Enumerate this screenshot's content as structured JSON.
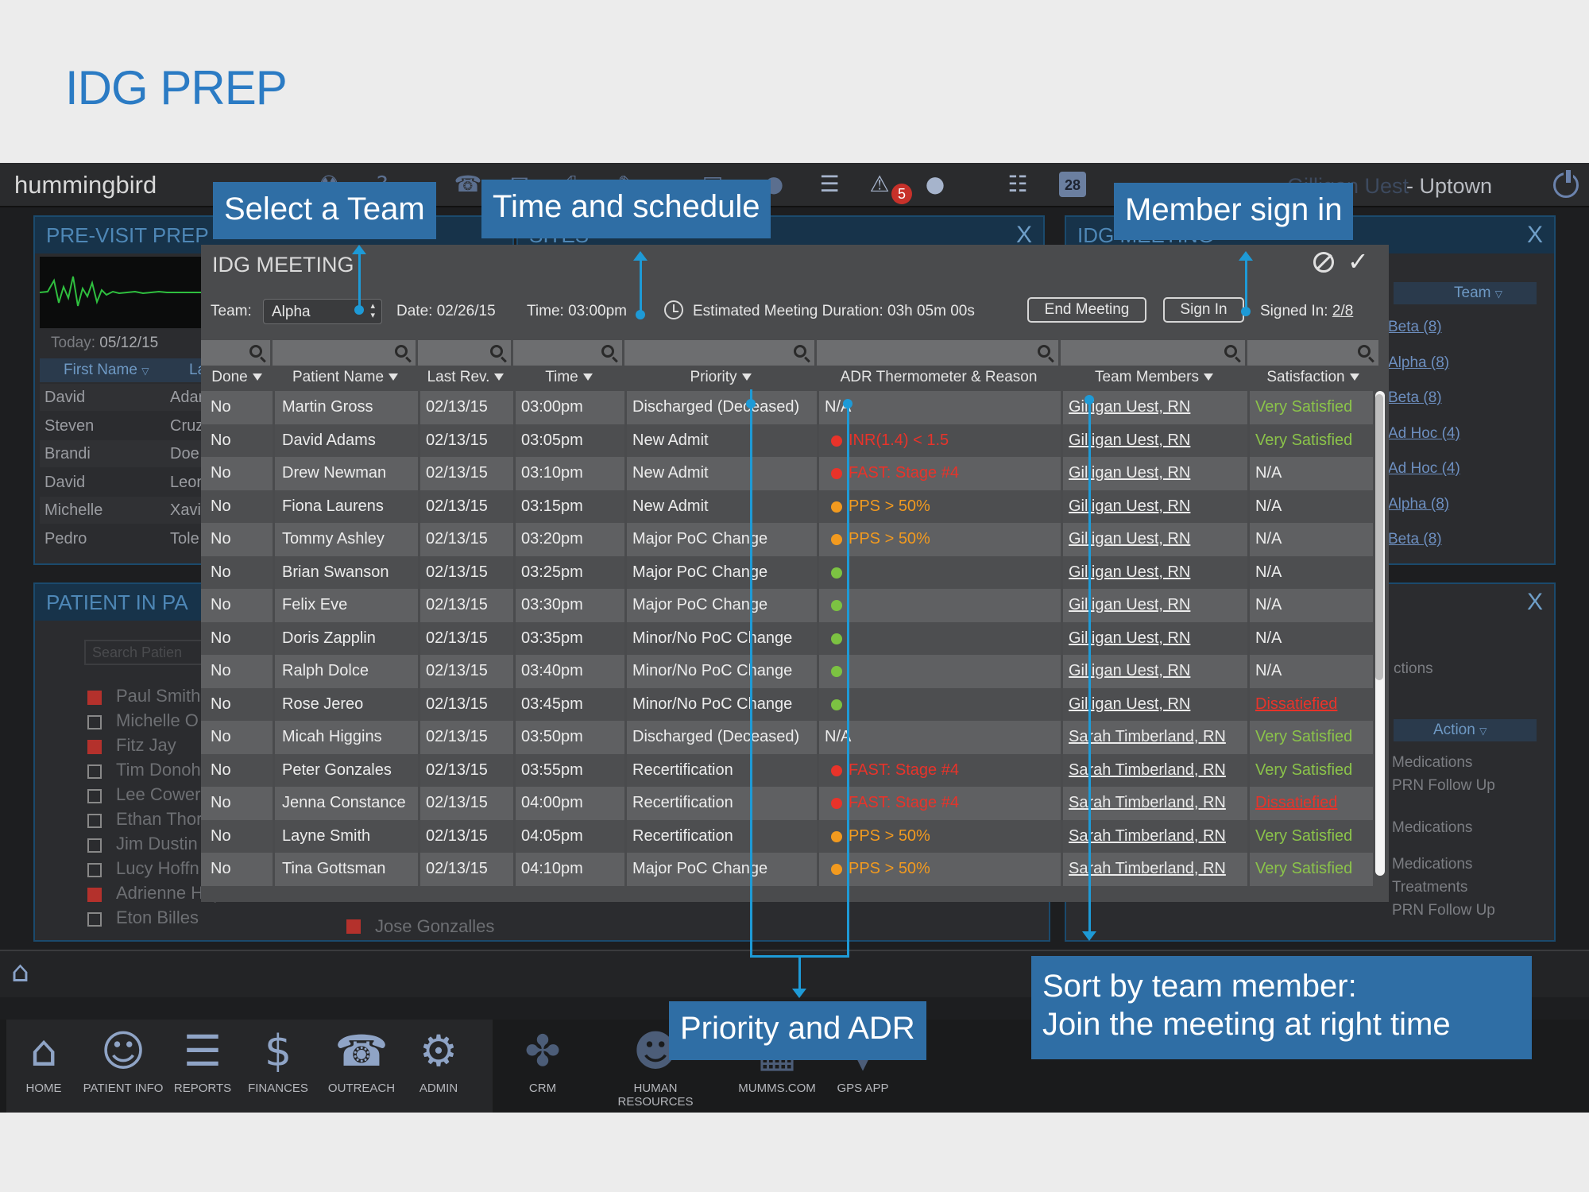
{
  "slide": {
    "title": "IDG PREP"
  },
  "topbar": {
    "brand": "hummingbird",
    "alert_count": "5",
    "calendar_day": "28",
    "user_name": "Gilligan Uest",
    "location": "- Uptown"
  },
  "previsit": {
    "title": "PRE-VISIT PREP",
    "today_label": "Today:",
    "today_value": "05/12/15",
    "col_first": "First Name",
    "col_last": "La",
    "rows": [
      {
        "first": "David",
        "last": "Adar"
      },
      {
        "first": "Steven",
        "last": "Cruz"
      },
      {
        "first": "Brandi",
        "last": "Doe"
      },
      {
        "first": "David",
        "last": "Leon"
      },
      {
        "first": "Michelle",
        "last": "Xavi"
      },
      {
        "first": "Pedro",
        "last": "Tole"
      }
    ]
  },
  "sites": {
    "title": "SITES"
  },
  "patient_panel": {
    "title": "PATIENT IN PA",
    "search_placeholder": "Search Patien",
    "items": [
      {
        "name": "Paul Smith",
        "checked": true
      },
      {
        "name": "Michelle O",
        "checked": false
      },
      {
        "name": "Fitz Jay",
        "checked": true
      },
      {
        "name": "Tim Donoh",
        "checked": false
      },
      {
        "name": "Lee Cower",
        "checked": false
      },
      {
        "name": "Ethan Thor",
        "checked": false
      },
      {
        "name": "Jim Dustin",
        "checked": false
      },
      {
        "name": "Lucy Hoffn",
        "checked": false
      },
      {
        "name": "Adrienne Hope",
        "checked": true
      },
      {
        "name": "Eton Billes",
        "checked": false
      }
    ],
    "extra_item": "Jose Gonzalles"
  },
  "idg_side": {
    "title": "IDG MEETING",
    "team_header": "Team",
    "teams": [
      "Beta (8)",
      "Alpha (8)",
      "Beta (8)",
      "Ad Hoc (4)",
      "Ad Hoc (4)",
      "Alpha (8)",
      "Beta (8)"
    ],
    "actions_label": "ctions",
    "action_header": "Action",
    "actions": [
      "Medications",
      "PRN Follow Up",
      "Medications",
      "Medications",
      "Treatments",
      "PRN Follow Up"
    ]
  },
  "modal": {
    "title": "IDG MEETING",
    "team_label": "Team:",
    "team_value": "Alpha",
    "date": "Date: 02/26/15",
    "time": "Time: 03:00pm",
    "duration": "Estimated Meeting Duration: 03h 05m 00s",
    "end_meeting": "End Meeting",
    "sign_in": "Sign In",
    "signed_label": "Signed In:",
    "signed_value": "2/8",
    "columns": {
      "done": "Done",
      "patient": "Patient Name",
      "last_rev": "Last Rev.",
      "time": "Time",
      "priority": "Priority",
      "adr": "ADR Thermometer & Reason",
      "team": "Team Members",
      "satisfaction": "Satisfaction"
    },
    "rows": [
      {
        "done": "No",
        "patient": "Martin Gross",
        "rev": "02/13/15",
        "time": "03:00pm",
        "priority": "Discharged (Deceased)",
        "adr_dot": "",
        "adr_text": "N/A",
        "adr_color": "#ececec",
        "member": "Gilligan Uest, RN",
        "sat": "Very Satisfied",
        "sat_class": "sat-green"
      },
      {
        "done": "No",
        "patient": "David Adams",
        "rev": "02/13/15",
        "time": "03:05pm",
        "priority": "New Admit",
        "adr_dot": "#e8332a",
        "adr_text": "INR(1.4) < 1.5",
        "adr_color": "#e8332a",
        "member": "Gilligan Uest, RN",
        "sat": "Very Satisfied",
        "sat_class": "sat-green"
      },
      {
        "done": "No",
        "patient": "Drew Newman",
        "rev": "02/13/15",
        "time": "03:10pm",
        "priority": "New Admit",
        "adr_dot": "#e8332a",
        "adr_text": "FAST: Stage #4",
        "adr_color": "#e8332a",
        "member": "Gilligan Uest, RN",
        "sat": "N/A",
        "sat_class": ""
      },
      {
        "done": "No",
        "patient": "Fiona Laurens",
        "rev": "02/13/15",
        "time": "03:15pm",
        "priority": "New Admit",
        "adr_dot": "#f29a1f",
        "adr_text": "PPS > 50%",
        "adr_color": "#f29a1f",
        "member": "Gilligan Uest, RN",
        "sat": "N/A",
        "sat_class": ""
      },
      {
        "done": "No",
        "patient": "Tommy Ashley",
        "rev": "02/13/15",
        "time": "03:20pm",
        "priority": "Major PoC Change",
        "adr_dot": "#f29a1f",
        "adr_text": "PPS > 50%",
        "adr_color": "#f29a1f",
        "member": "Gilligan Uest, RN",
        "sat": "N/A",
        "sat_class": ""
      },
      {
        "done": "No",
        "patient": "Brian Swanson",
        "rev": "02/13/15",
        "time": "03:25pm",
        "priority": "Major PoC Change",
        "adr_dot": "#7cc242",
        "adr_text": "",
        "adr_color": "#ececec",
        "member": "Gilligan Uest, RN",
        "sat": "N/A",
        "sat_class": ""
      },
      {
        "done": "No",
        "patient": "Felix Eve",
        "rev": "02/13/15",
        "time": "03:30pm",
        "priority": "Major PoC Change",
        "adr_dot": "#7cc242",
        "adr_text": "",
        "adr_color": "#ececec",
        "member": "Gilligan Uest, RN",
        "sat": "N/A",
        "sat_class": ""
      },
      {
        "done": "No",
        "patient": "Doris Zapplin",
        "rev": "02/13/15",
        "time": "03:35pm",
        "priority": "Minor/No PoC Change",
        "adr_dot": "#7cc242",
        "adr_text": "",
        "adr_color": "#ececec",
        "member": "Gilligan Uest, RN",
        "sat": "N/A",
        "sat_class": ""
      },
      {
        "done": "No",
        "patient": "Ralph Dolce",
        "rev": "02/13/15",
        "time": "03:40pm",
        "priority": "Minor/No PoC Change",
        "adr_dot": "#7cc242",
        "adr_text": "",
        "adr_color": "#ececec",
        "member": "Gilligan Uest, RN",
        "sat": "N/A",
        "sat_class": ""
      },
      {
        "done": "No",
        "patient": "Rose Jereo",
        "rev": "02/13/15",
        "time": "03:45pm",
        "priority": "Minor/No PoC Change",
        "adr_dot": "#7cc242",
        "adr_text": "",
        "adr_color": "#ececec",
        "member": "Gilligan Uest, RN",
        "sat": "Dissatiefied",
        "sat_class": "sat-red"
      },
      {
        "done": "No",
        "patient": "Micah Higgins",
        "rev": "02/13/15",
        "time": "03:50pm",
        "priority": "Discharged (Deceased)",
        "adr_dot": "",
        "adr_text": "N/A",
        "adr_color": "#ececec",
        "member": "Sarah Timberland, RN",
        "sat": "Very Satisfied",
        "sat_class": "sat-green"
      },
      {
        "done": "No",
        "patient": "Peter Gonzales",
        "rev": "02/13/15",
        "time": "03:55pm",
        "priority": "Recertification",
        "adr_dot": "#e8332a",
        "adr_text": "FAST: Stage #4",
        "adr_color": "#e8332a",
        "member": "Sarah Timberland, RN",
        "sat": "Very Satisfied",
        "sat_class": "sat-green"
      },
      {
        "done": "No",
        "patient": "Jenna Constance",
        "rev": "02/13/15",
        "time": "04:00pm",
        "priority": "Recertification",
        "adr_dot": "#e8332a",
        "adr_text": "FAST: Stage #4",
        "adr_color": "#e8332a",
        "member": "Sarah Timberland, RN",
        "sat": "Dissatiefied",
        "sat_class": "sat-red"
      },
      {
        "done": "No",
        "patient": "Layne Smith",
        "rev": "02/13/15",
        "time": "04:05pm",
        "priority": "Recertification",
        "adr_dot": "#f29a1f",
        "adr_text": "PPS > 50%",
        "adr_color": "#f29a1f",
        "member": "Sarah Timberland, RN",
        "sat": "Very Satisfied",
        "sat_class": "sat-green"
      },
      {
        "done": "No",
        "patient": "Tina Gottsman",
        "rev": "02/13/15",
        "time": "04:10pm",
        "priority": "Major PoC Change",
        "adr_dot": "#f29a1f",
        "adr_text": "PPS > 50%",
        "adr_color": "#f29a1f",
        "member": "Sarah Timberland, RN",
        "sat": "Very Satisfied",
        "sat_class": "sat-green"
      }
    ]
  },
  "dock": {
    "items": [
      {
        "label": "HOME",
        "icon": "home-icon"
      },
      {
        "label": "PATIENT INFO",
        "icon": "person-icon"
      },
      {
        "label": "REPORTS",
        "icon": "reports-icon"
      },
      {
        "label": "FINANCES",
        "icon": "dollar-icon"
      },
      {
        "label": "OUTREACH",
        "icon": "phone-icon"
      },
      {
        "label": "ADMIN",
        "icon": "gear-icon"
      },
      {
        "label": "CRM",
        "icon": "handshake-icon"
      },
      {
        "label": "HUMAN RESOURCES",
        "icon": "people-icon"
      },
      {
        "label": "MUMMS.COM",
        "icon": "mumms-icon"
      },
      {
        "label": "GPS APP",
        "icon": "map-pin-icon"
      }
    ]
  },
  "annotations": {
    "select_team": "Select a Team",
    "time_schedule": "Time and schedule",
    "member_sign_in": "Member sign in",
    "priority_adr": "Priority and ADR",
    "sort_line1": "Sort by team member:",
    "sort_line2": "Join the meeting at right time"
  },
  "colors": {
    "accent_blue": "#2b7bc4",
    "callout_bg": "#2f6ea5",
    "annotation_line": "#1e9ad6",
    "status_red": "#e8332a",
    "status_orange": "#f29a1f",
    "status_green": "#7cc242",
    "satisfied_green": "#8bc34a"
  }
}
